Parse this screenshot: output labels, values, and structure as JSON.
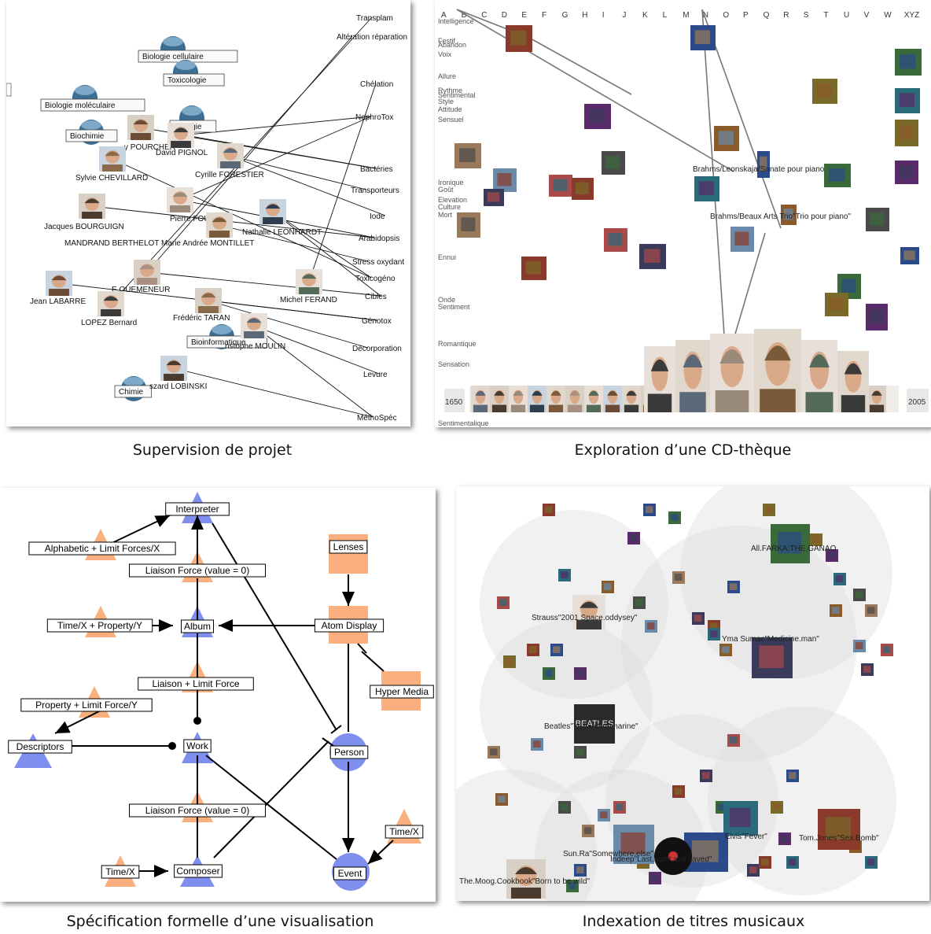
{
  "captions": {
    "q1": "Supervision de projet",
    "q2": "Exploration d’une CD-thèque",
    "q3": "Spécification formelle d’une visualisation",
    "q4": "Indexation de titres musicaux"
  },
  "colors": {
    "blue_node": "#7f8ff0",
    "orange_node": "#f9b07e",
    "sphere": "#3b6e92",
    "circle_bg": "#d9d9d9"
  },
  "supervision": {
    "categories": [
      "Biologie cellulaire",
      "Toxicologie",
      "Biologie moléculaire",
      "Biochimie",
      "Biologie",
      "Bioinformatique",
      "Chimie"
    ],
    "people": [
      "y POURCHER",
      "David PIGNOL",
      "Sylvie CHEVILLARD",
      "Cyrille FORESTIER",
      "Jacques BOURGUIGN",
      "Pierre FOUCHE",
      "Nathalie LEONHARDT",
      "MANDRAND BERTHELOT Marie Andrée MONTILLET",
      "E QUEMENEUR",
      "Michel FERAND",
      "Jean LABARRE",
      "LOPEZ Bernard",
      "Frédéric TARAN",
      "nstophe MOULIN",
      "szard LOBINSKI"
    ],
    "topics": [
      "Transplam",
      "Altération réparation",
      "Chélation",
      "NephroTox",
      "Bactéries",
      "Transporteurs",
      "Iode",
      "Arabidopsis",
      "Stress oxydant",
      "Toxicogéno",
      "Cibles",
      "Génotox",
      "Décorporation",
      "Levure",
      "MéthoSpéc"
    ]
  },
  "cdtheque": {
    "letters": [
      "A",
      "B",
      "C",
      "D",
      "E",
      "F",
      "G",
      "H",
      "I",
      "J",
      "K",
      "L",
      "M",
      "N",
      "O",
      "P",
      "Q",
      "R",
      "S",
      "T",
      "U",
      "V",
      "W",
      "XYZ"
    ],
    "left_labels": [
      "Intelligence",
      "Festif",
      "Abandon",
      "Voix",
      "Allure",
      "Rythme",
      "Sentimental",
      "Style",
      "Attitude",
      "Sensuel",
      "Ironique",
      "Goût",
      "Elevation",
      "Culture",
      "Mort",
      "Ennui",
      "Onde",
      "Sentiment",
      "Romantique",
      "Sensation",
      "Sentimentalique"
    ],
    "annotations": [
      "Brahms/Leonskaja/Sonate pour piano",
      "Brahms/Beaux Arts Trio\"Trio pour piano\""
    ],
    "year_start": "1650",
    "year_end": "2005"
  },
  "spec": {
    "nodes": [
      "Interpreter",
      "Alphabetic + Limit Forces/X",
      "Liaison Force (value = 0)",
      "Lenses",
      "Time/X + Property/Y",
      "Album",
      "Atom Display",
      "Liaison + Limit Force",
      "Hyper Media",
      "Property + Limit Force/Y",
      "Descriptors",
      "Work",
      "Person",
      "Liaison Force (value = 0)",
      "Time/X",
      "Time/X",
      "Composer",
      "Event"
    ]
  },
  "indexation": {
    "labels": [
      "All.FARKA.THE.GANAO",
      "Strauss\"2001 Space.oddysey\"",
      "Yma Sumac\"Medicine.man\"",
      "Beatles\"Yellow.Submarine\"",
      "Elvis\"Fever\"",
      "Tom.Jones\"Sex.Bomb\"",
      "Sun.Ra\"Somewhere.else\"",
      "Indeep\"Last.night.a.dj.saved\"",
      "The.Moog.Cookbook\"Born to be wild\""
    ],
    "beatles_sleeve": "BEATLES"
  }
}
